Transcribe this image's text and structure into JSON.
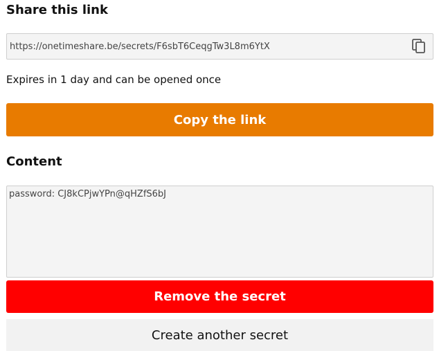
{
  "share": {
    "heading": "Share this link",
    "url": "https://onetimeshare.be/secrets/F6sbT6CeqgTw3L8m6YtX",
    "copy_icon": "copy-icon",
    "expires_text": "Expires in 1 day and can be opened once",
    "copy_button_label": "Copy the link"
  },
  "content": {
    "heading": "Content",
    "secret_value": "password: CJ8kCPjwYPn@qHZfS6bJ"
  },
  "actions": {
    "remove_label": "Remove the secret",
    "create_label": "Create another secret"
  },
  "colors": {
    "copy_button": "#e87b00",
    "remove_button": "#ff0000",
    "create_button": "#f2f2f2",
    "field_background": "#f4f4f4"
  }
}
